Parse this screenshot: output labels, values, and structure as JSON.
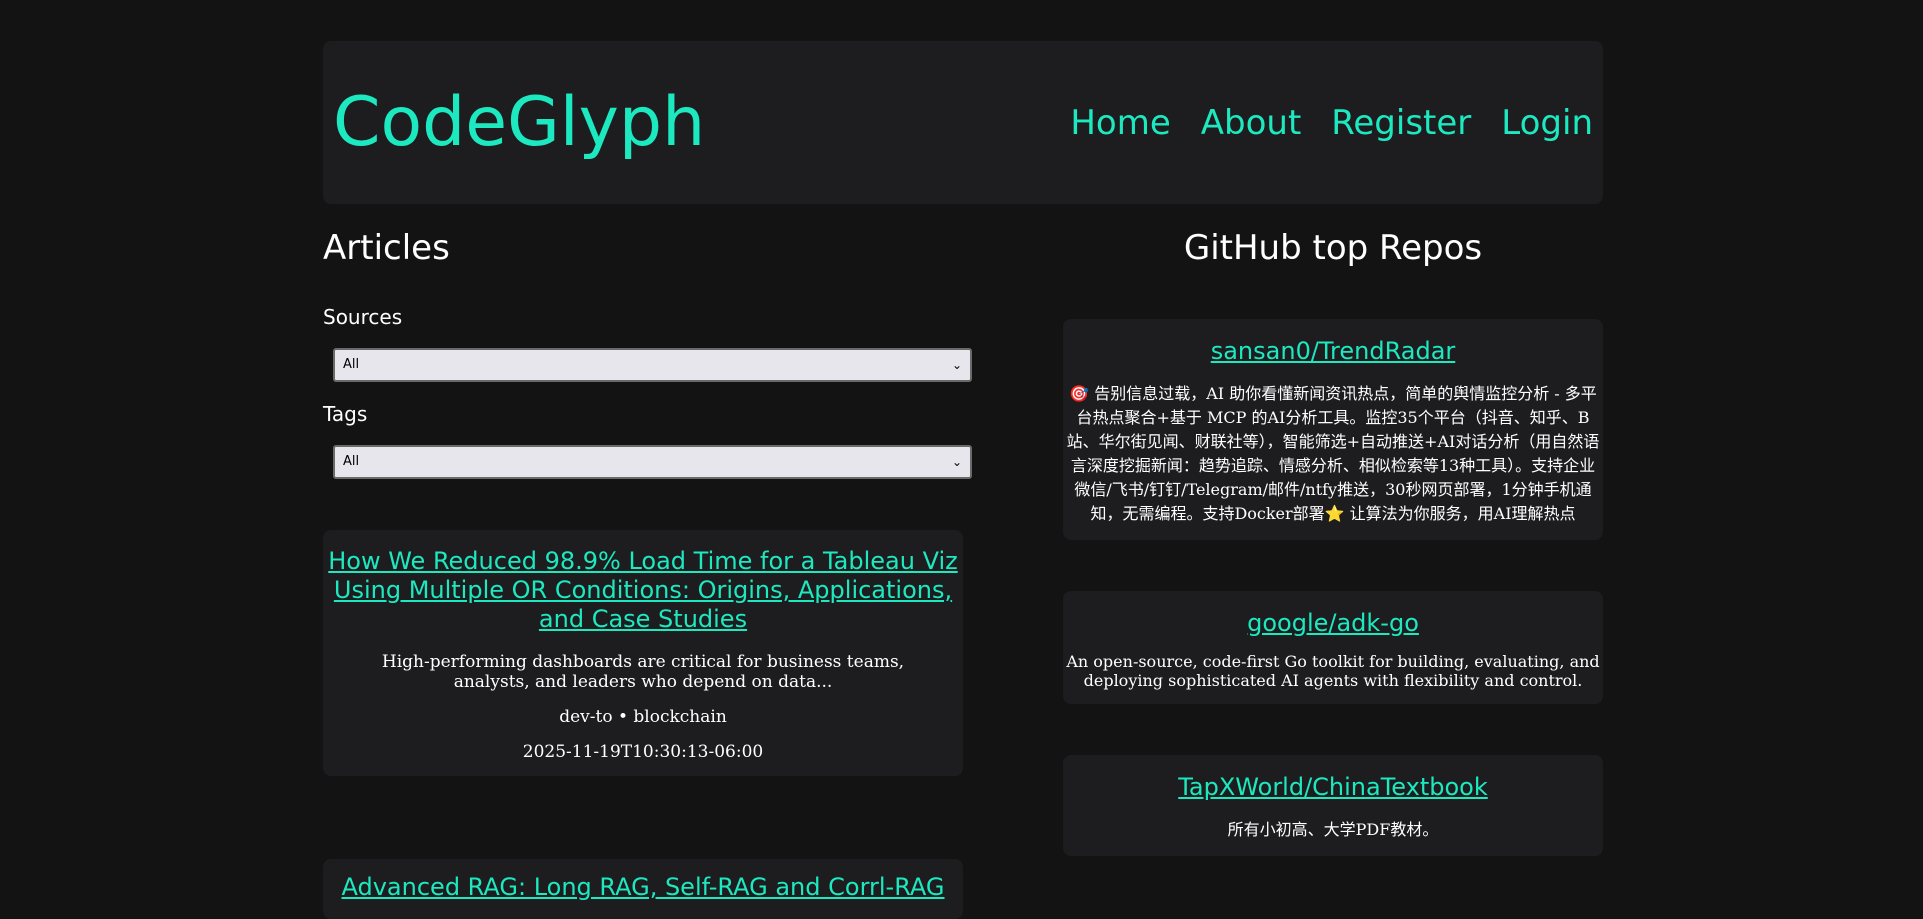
{
  "header": {
    "logo": "CodeGlyph",
    "nav": [
      "Home",
      "About",
      "Register",
      "Login"
    ]
  },
  "articles": {
    "heading": "Articles",
    "sources_label": "Sources",
    "sources_value": "All",
    "tags_label": "Tags",
    "tags_value": "All",
    "items": [
      {
        "title": "How We Reduced 98.9% Load Time for a Tableau Viz Using Multiple OR Conditions: Origins, Applications, and Case Studies",
        "description": "High-performing dashboards are critical for business teams, analysts, and leaders who depend on data...",
        "meta": "dev-to • blockchain",
        "date": "2025-11-19T10:30:13-06:00"
      },
      {
        "title": "Advanced RAG: Long RAG, Self-RAG and Corrl-RAG"
      }
    ]
  },
  "repos": {
    "heading": "GitHub top Repos",
    "items": [
      {
        "name": "sansan0/TrendRadar",
        "description": "🎯 告别信息过载，AI 助你看懂新闻资讯热点，简单的舆情监控分析 - 多平台热点聚合+基于 MCP 的AI分析工具。监控35个平台（抖音、知乎、B站、华尔街见闻、财联社等），智能筛选+自动推送+AI对话分析（用自然语言深度挖掘新闻：趋势追踪、情感分析、相似检索等13种工具）。支持企业微信/飞书/钉钉/Telegram/邮件/ntfy推送，30秒网页部署，1分钟手机通知，无需编程。支持Docker部署⭐ 让算法为你服务，用AI理解热点"
      },
      {
        "name": "google/adk-go",
        "description": "An open-source, code-first Go toolkit for building, evaluating, and deploying sophisticated AI agents with flexibility and control."
      },
      {
        "name": "TapXWorld/ChinaTextbook",
        "description": "所有小初高、大学PDF教材。"
      }
    ]
  }
}
